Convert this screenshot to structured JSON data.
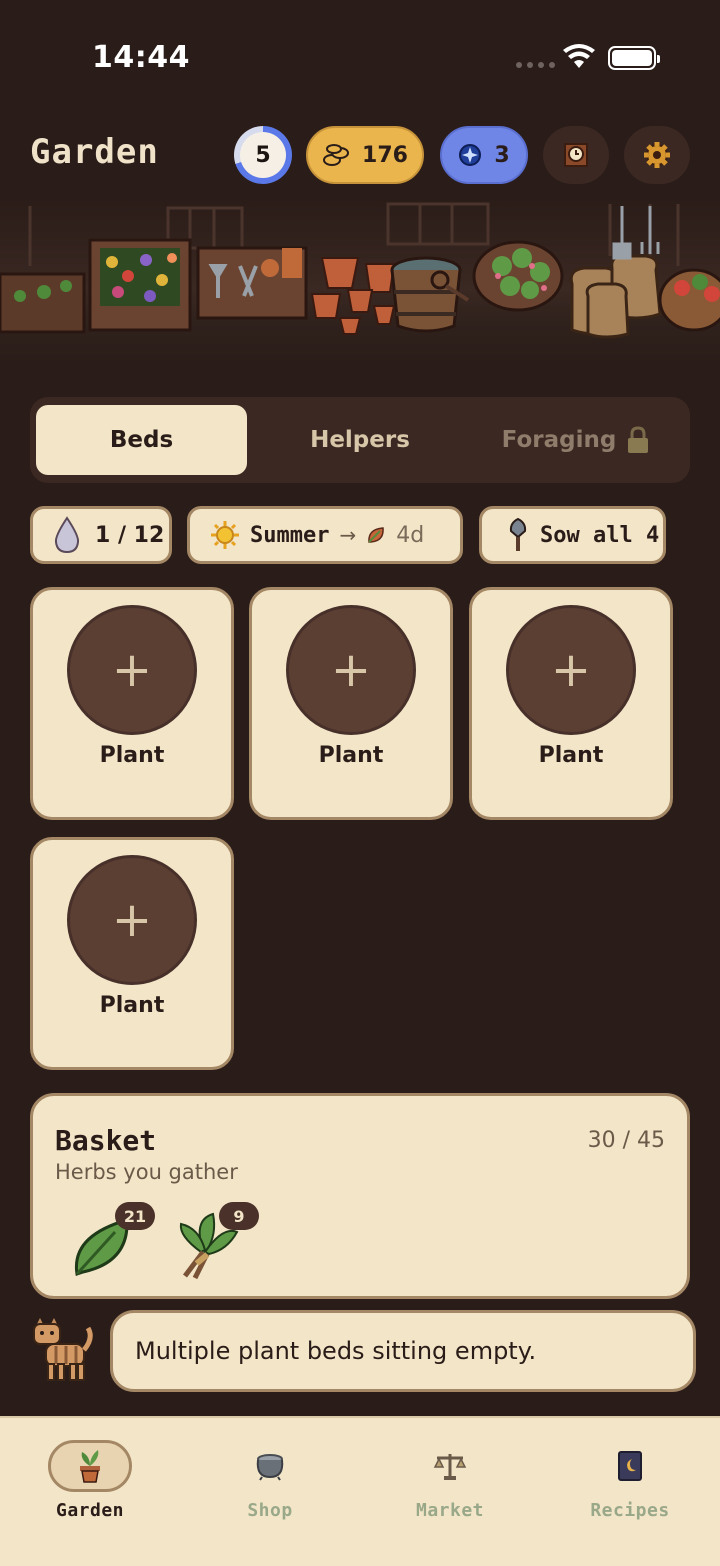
{
  "status_bar": {
    "time": "14:44"
  },
  "header": {
    "title": "Garden",
    "level": "5",
    "coins": "176",
    "gems": "3",
    "level_progress": 0.7
  },
  "tabs": [
    {
      "label": "Beds",
      "active": true
    },
    {
      "label": "Helpers",
      "active": false
    },
    {
      "label": "Foraging",
      "active": false,
      "locked": true
    }
  ],
  "chips": {
    "water": "1 / 12",
    "season": "Summer",
    "season_arrow": "→",
    "season_days": "4d",
    "sow_all": "Sow all 4"
  },
  "beds": [
    {
      "label": "Plant",
      "icon": "plus-icon"
    },
    {
      "label": "Plant",
      "icon": "plus-icon"
    },
    {
      "label": "Plant",
      "icon": "plus-icon"
    },
    {
      "label": "Plant",
      "icon": "plus-icon"
    }
  ],
  "basket": {
    "title": "Basket",
    "count": "30 / 45",
    "subtitle": "Herbs you gather",
    "items": [
      {
        "icon": "leaf-icon",
        "count": "21"
      },
      {
        "icon": "herb-bundle-icon",
        "count": "9"
      }
    ]
  },
  "hint": {
    "text": "Multiple plant beds sitting empty."
  },
  "nav": [
    {
      "label": "Garden",
      "icon": "potted-plant-icon",
      "active": true
    },
    {
      "label": "Shop",
      "icon": "cauldron-icon",
      "active": false
    },
    {
      "label": "Market",
      "icon": "scales-icon",
      "active": false
    },
    {
      "label": "Recipes",
      "icon": "recipe-book-icon",
      "active": false
    }
  ],
  "colors": {
    "background": "#2a1c18",
    "card": "#f3e5c7",
    "card_border": "#a48765",
    "coins": "#e9b54c",
    "gems": "#6f86e6",
    "level_ring": "#5a78e8"
  }
}
